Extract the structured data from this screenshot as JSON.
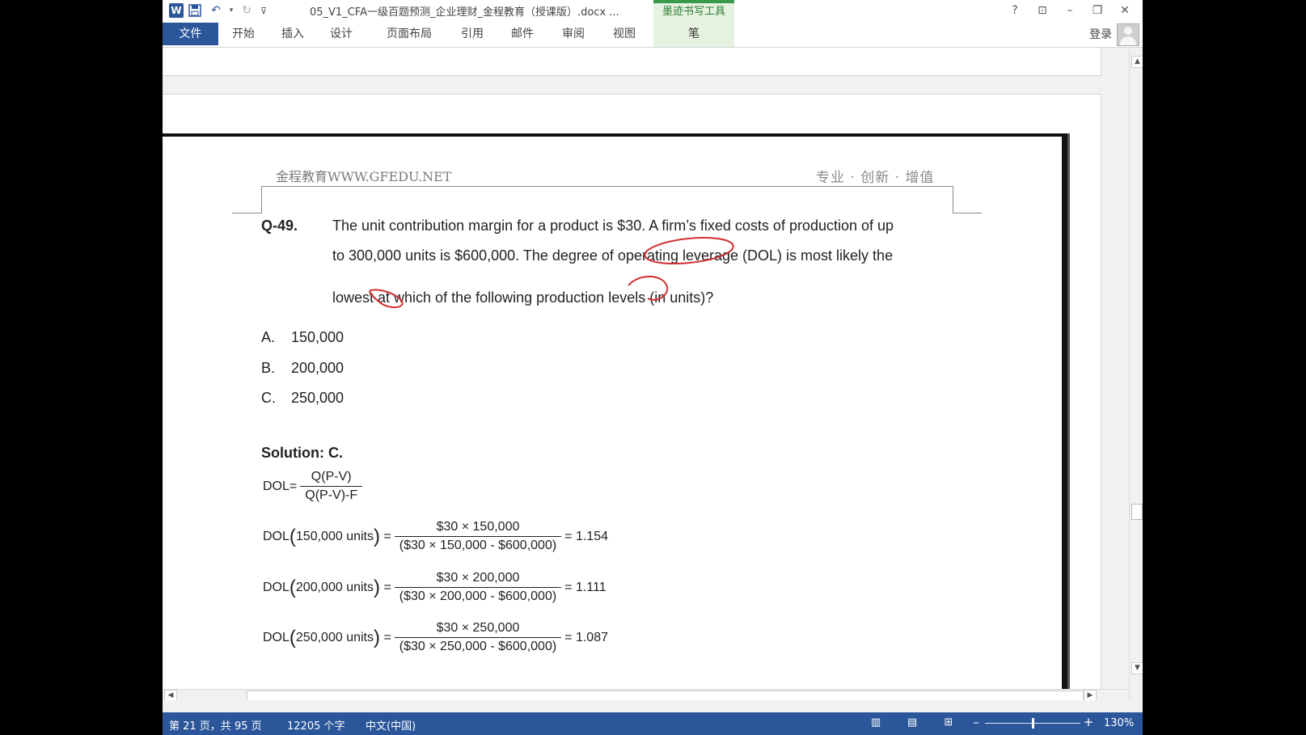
{
  "window": {
    "title": "05_V1_CFA一级百题预测_企业理财_金程教育（授课版）.docx ...",
    "context_tab_title": "墨迹书写工具",
    "controls": {
      "help": "?",
      "ribbon_display": "⊡",
      "minimize": "–",
      "restore": "❐",
      "close": "✕"
    }
  },
  "qat": {
    "app_icon": "W",
    "save_icon": "💾",
    "undo_icon": "↶",
    "redo_icon": "↻",
    "customize_icon": "⊽"
  },
  "ribbon": {
    "file_tab": "文件",
    "tabs": [
      "开始",
      "插入",
      "设计",
      "页面布局",
      "引用",
      "邮件",
      "审阅",
      "视图"
    ],
    "pen_tab": "笔",
    "login": "登录"
  },
  "document": {
    "header_left": "金程教育WWW.GFEDU.NET",
    "header_right": "专业 · 创新 · 增值",
    "question_number": "Q-49.",
    "question_lines": [
      "The unit contribution margin for a product is $30. A firm’s fixed costs of production of up",
      "to 300,000 units is $600,000. The degree of operating leverage (DOL) is most likely the",
      "lowest at which of the following production levels (in units)?"
    ],
    "options": [
      {
        "label": "A.",
        "value": "150,000"
      },
      {
        "label": "B.",
        "value": "200,000"
      },
      {
        "label": "C.",
        "value": "250,000"
      }
    ],
    "solution_label": "Solution: C.",
    "dol_formula": {
      "lhs": "DOL=",
      "numerator": "Q(P-V)",
      "denominator": "Q(P-V)-F"
    },
    "dol_calcs": [
      {
        "units": "150,000",
        "lhs_label": "units",
        "numerator": "$30 × 150,000",
        "denominator": "$30 × 150,000 - $600,000",
        "result": "= 1.154"
      },
      {
        "units": "200,000",
        "lhs_label": "units",
        "numerator": "$30 × 200,000",
        "denominator": "$30 × 200,000 - $600,000",
        "result": "= 1.111"
      },
      {
        "units": "250,000",
        "lhs_label": "units",
        "numerator": "$30 × 250,000",
        "denominator": "$30 × 250,000 - $600,000",
        "result": "= 1.087"
      }
    ]
  },
  "status": {
    "page": "第 21 页，共 95 页",
    "words": "12205 个字",
    "language": "中文(中国)",
    "zoom": "130%",
    "zoom_level_fraction": 0.5
  },
  "colors": {
    "accent": "#2b579a",
    "ink": "#d32f2f",
    "pen_tab_bg": "#e6f2e0"
  }
}
